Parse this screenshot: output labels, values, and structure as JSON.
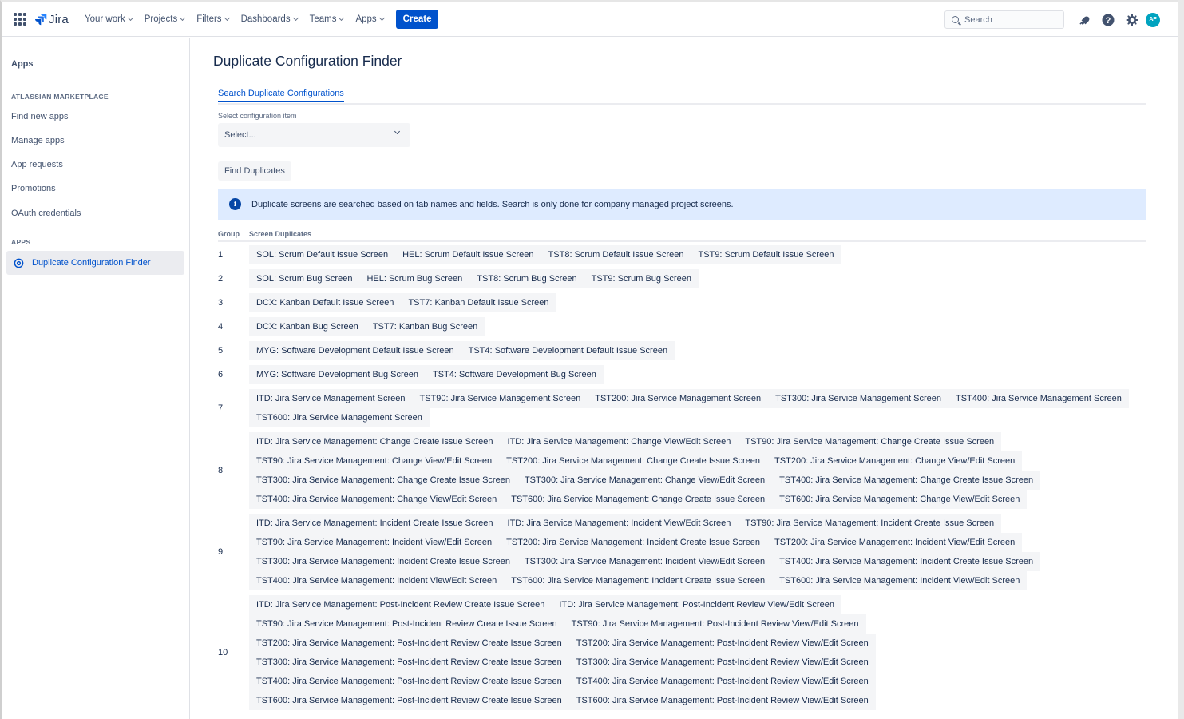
{
  "nav": {
    "logo": "Jira",
    "items": [
      "Your work",
      "Projects",
      "Filters",
      "Dashboards",
      "Teams",
      "Apps"
    ],
    "create": "Create",
    "search_placeholder": "Search",
    "avatar": "AF"
  },
  "sidebar": {
    "title": "Apps",
    "marketplace_heading": "ATLASSIAN MARKETPLACE",
    "links": [
      "Find new apps",
      "Manage apps",
      "App requests",
      "Promotions",
      "OAuth credentials"
    ],
    "apps_heading": "APPS",
    "active_item": "Duplicate Configuration Finder"
  },
  "main": {
    "title": "Duplicate Configuration Finder",
    "tab": "Search Duplicate Configurations",
    "select_label": "Select configuration item",
    "select_value": "Select...",
    "find_button": "Find Duplicates",
    "info": "Duplicate screens are searched based on tab names and fields. Search is only done for company managed project screens.",
    "col_group": "Group",
    "col_dups": "Screen Duplicates"
  },
  "groups": [
    {
      "num": "1",
      "lines": [
        [
          "SOL: Scrum Default Issue Screen",
          "HEL: Scrum Default Issue Screen",
          "TST8: Scrum Default Issue Screen",
          "TST9: Scrum Default Issue Screen"
        ]
      ]
    },
    {
      "num": "2",
      "lines": [
        [
          "SOL: Scrum Bug Screen",
          "HEL: Scrum Bug Screen",
          "TST8: Scrum Bug Screen",
          "TST9: Scrum Bug Screen"
        ]
      ]
    },
    {
      "num": "3",
      "lines": [
        [
          "DCX: Kanban Default Issue Screen",
          "TST7: Kanban Default Issue Screen"
        ]
      ]
    },
    {
      "num": "4",
      "lines": [
        [
          "DCX: Kanban Bug Screen",
          "TST7: Kanban Bug Screen"
        ]
      ]
    },
    {
      "num": "5",
      "lines": [
        [
          "MYG: Software Development Default Issue Screen",
          "TST4: Software Development Default Issue Screen"
        ]
      ]
    },
    {
      "num": "6",
      "lines": [
        [
          "MYG: Software Development Bug Screen",
          "TST4: Software Development Bug Screen"
        ]
      ]
    },
    {
      "num": "7",
      "lines": [
        [
          "ITD: Jira Service Management Screen",
          "TST90: Jira Service Management Screen",
          "TST200: Jira Service Management Screen",
          "TST300: Jira Service Management Screen",
          "TST400: Jira Service Management Screen"
        ],
        [
          "TST600: Jira Service Management Screen"
        ]
      ]
    },
    {
      "num": "8",
      "lines": [
        [
          "ITD: Jira Service Management: Change Create Issue Screen",
          "ITD: Jira Service Management: Change View/Edit Screen",
          "TST90: Jira Service Management: Change Create Issue Screen"
        ],
        [
          "TST90: Jira Service Management: Change View/Edit Screen",
          "TST200: Jira Service Management: Change Create Issue Screen",
          "TST200: Jira Service Management: Change View/Edit Screen"
        ],
        [
          "TST300: Jira Service Management: Change Create Issue Screen",
          "TST300: Jira Service Management: Change View/Edit Screen",
          "TST400: Jira Service Management: Change Create Issue Screen"
        ],
        [
          "TST400: Jira Service Management: Change View/Edit Screen",
          "TST600: Jira Service Management: Change Create Issue Screen",
          "TST600: Jira Service Management: Change View/Edit Screen"
        ]
      ]
    },
    {
      "num": "9",
      "lines": [
        [
          "ITD: Jira Service Management: Incident Create Issue Screen",
          "ITD: Jira Service Management: Incident View/Edit Screen",
          "TST90: Jira Service Management: Incident Create Issue Screen"
        ],
        [
          "TST90: Jira Service Management: Incident View/Edit Screen",
          "TST200: Jira Service Management: Incident Create Issue Screen",
          "TST200: Jira Service Management: Incident View/Edit Screen"
        ],
        [
          "TST300: Jira Service Management: Incident Create Issue Screen",
          "TST300: Jira Service Management: Incident View/Edit Screen",
          "TST400: Jira Service Management: Incident Create Issue Screen"
        ],
        [
          "TST400: Jira Service Management: Incident View/Edit Screen",
          "TST600: Jira Service Management: Incident Create Issue Screen",
          "TST600: Jira Service Management: Incident View/Edit Screen"
        ]
      ]
    },
    {
      "num": "10",
      "lines": [
        [
          "ITD: Jira Service Management: Post-Incident Review Create Issue Screen",
          "ITD: Jira Service Management: Post-Incident Review View/Edit Screen"
        ],
        [
          "TST90: Jira Service Management: Post-Incident Review Create Issue Screen",
          "TST90: Jira Service Management: Post-Incident Review View/Edit Screen"
        ],
        [
          "TST200: Jira Service Management: Post-Incident Review Create Issue Screen",
          "TST200: Jira Service Management: Post-Incident Review View/Edit Screen"
        ],
        [
          "TST300: Jira Service Management: Post-Incident Review Create Issue Screen",
          "TST300: Jira Service Management: Post-Incident Review View/Edit Screen"
        ],
        [
          "TST400: Jira Service Management: Post-Incident Review Create Issue Screen",
          "TST400: Jira Service Management: Post-Incident Review View/Edit Screen"
        ],
        [
          "TST600: Jira Service Management: Post-Incident Review Create Issue Screen",
          "TST600: Jira Service Management: Post-Incident Review View/Edit Screen"
        ]
      ]
    }
  ]
}
